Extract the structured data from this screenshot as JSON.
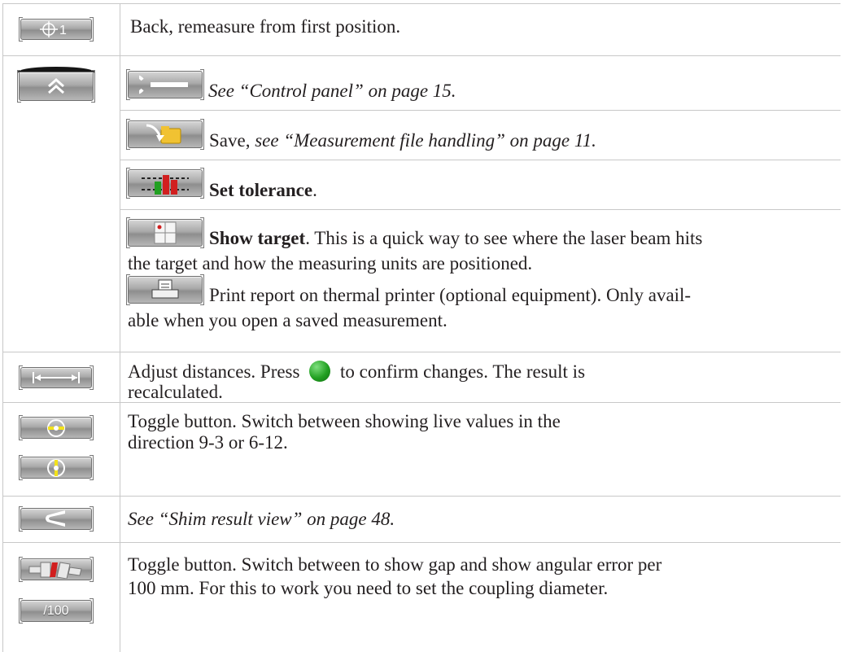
{
  "rows": [
    {
      "button": "+1",
      "text": "Back, remeasure from first position."
    },
    {
      "button": "chevron-up-double"
    },
    {
      "sub_text_prefix": "See “Control panel” on page 15."
    },
    {
      "save_plain": "Save, ",
      "save_italic": "see “Measurement file handling” on page 11."
    },
    {
      "tol_bold": "Set tolerance",
      "tol_tail": "."
    },
    {
      "target_bold": "Show target",
      "target_tail": ". This is a quick way to see where the laser beam hits",
      "target_line2": "the target and how the measuring units are positioned."
    },
    {
      "print_line1": "Print report on thermal printer (optional equipment). Only avail-",
      "print_line2": "able when you open a saved measurement."
    },
    {
      "dist_pre": "Adjust distances. Press ",
      "dist_post": " to confirm changes. The result is",
      "dist_line2": "recalculated."
    },
    {
      "toggle1_line1": "Toggle button. Switch between showing live values in the",
      "toggle1_line2": "direction 9-3 or 6-12."
    },
    {
      "shim": "See “Shim result view” on page 48."
    },
    {
      "toggle2_line1": "Toggle button. Switch between to show gap and show angular error per",
      "toggle2_line2": "100 mm. For this to work you need to set the coupling diameter.",
      "btn_label": "/100"
    }
  ],
  "icons": {
    "accent_green": "#22a022",
    "accent_red": "#d11f1f",
    "accent_yellow": "#f3e21b"
  }
}
